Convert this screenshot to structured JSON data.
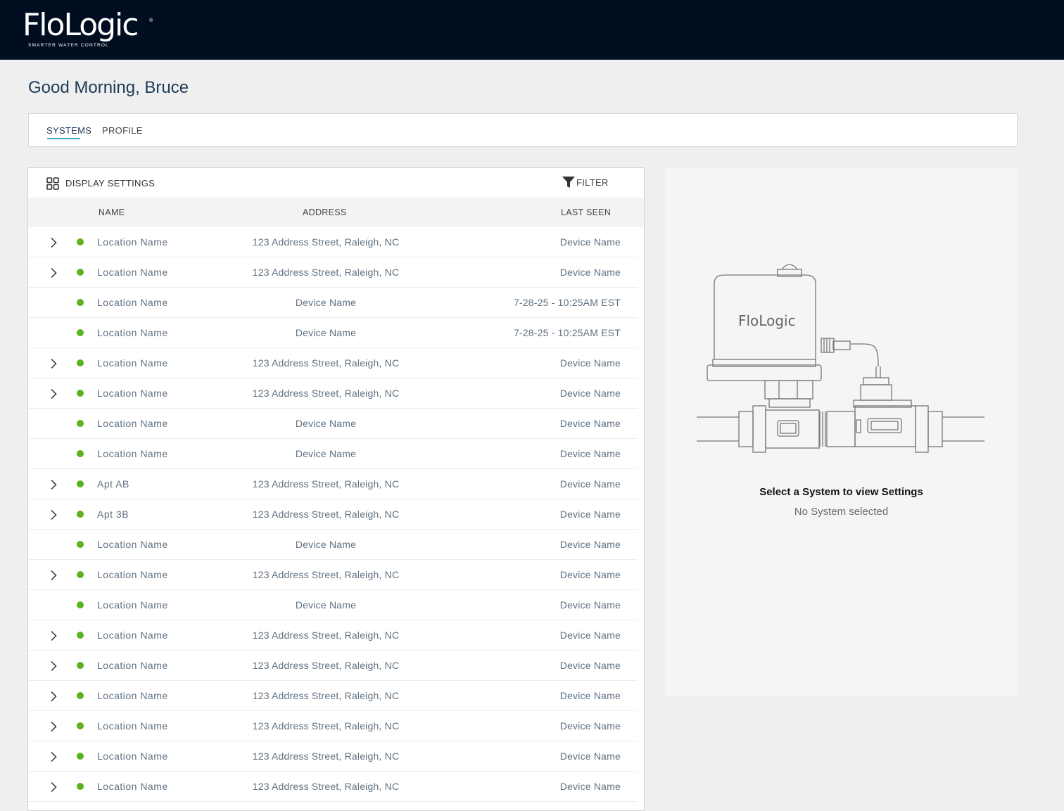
{
  "brand": {
    "name": "FloLogic",
    "registered_mark": "®",
    "tagline": "SMARTER WATER CONTROL"
  },
  "greeting": "Good Morning, Bruce",
  "tabs": [
    {
      "label": "SYSTEMS",
      "active": true
    },
    {
      "label": "PROFILE",
      "active": false
    }
  ],
  "toolbar": {
    "display_settings_label": "DISPLAY SETTINGS",
    "filter_label": "FILTER"
  },
  "table": {
    "columns": {
      "name": "NAME",
      "address": "ADDRESS",
      "last_seen": "LAST SEEN"
    },
    "rows": [
      {
        "expandable": true,
        "status": "online",
        "name": "Location  Name",
        "address": "123 Address Street, Raleigh, NC",
        "last_seen": "Device Name"
      },
      {
        "expandable": true,
        "status": "online",
        "name": "Location  Name",
        "address": "123 Address Street, Raleigh, NC",
        "last_seen": "Device Name"
      },
      {
        "expandable": false,
        "status": "online",
        "name": "Location  Name",
        "address": "Device Name",
        "last_seen": "7-28-25 - 10:25AM EST"
      },
      {
        "expandable": false,
        "status": "online",
        "name": "Location  Name",
        "address": "Device Name",
        "last_seen": "7-28-25 - 10:25AM EST"
      },
      {
        "expandable": true,
        "status": "online",
        "name": "Location  Name",
        "address": "123 Address Street, Raleigh, NC",
        "last_seen": "Device Name"
      },
      {
        "expandable": true,
        "status": "online",
        "name": "Location  Name",
        "address": "123 Address Street, Raleigh, NC",
        "last_seen": "Device Name"
      },
      {
        "expandable": false,
        "status": "online",
        "name": "Location  Name",
        "address": "Device Name",
        "last_seen": "Device Name"
      },
      {
        "expandable": false,
        "status": "online",
        "name": "Location  Name",
        "address": "Device Name",
        "last_seen": "Device Name"
      },
      {
        "expandable": true,
        "status": "online",
        "name": "Apt AB",
        "address": "123 Address Street, Raleigh, NC",
        "last_seen": "Device Name"
      },
      {
        "expandable": true,
        "status": "online",
        "name": "Apt 3B",
        "address": "123 Address Street, Raleigh, NC",
        "last_seen": "Device Name"
      },
      {
        "expandable": false,
        "status": "online",
        "name": "Location  Name",
        "address": "Device Name",
        "last_seen": "Device Name"
      },
      {
        "expandable": true,
        "status": "online",
        "name": "Location  Name",
        "address": "123 Address Street, Raleigh, NC",
        "last_seen": "Device Name"
      },
      {
        "expandable": false,
        "status": "online",
        "name": "Location  Name",
        "address": "Device Name",
        "last_seen": "Device Name"
      },
      {
        "expandable": true,
        "status": "online",
        "name": "Location  Name",
        "address": "123 Address Street, Raleigh, NC",
        "last_seen": "Device Name"
      },
      {
        "expandable": true,
        "status": "online",
        "name": "Location  Name",
        "address": "123 Address Street, Raleigh, NC",
        "last_seen": "Device Name"
      },
      {
        "expandable": true,
        "status": "online",
        "name": "Location  Name",
        "address": "123 Address Street, Raleigh, NC",
        "last_seen": "Device Name"
      },
      {
        "expandable": true,
        "status": "online",
        "name": "Location  Name",
        "address": "123 Address Street, Raleigh, NC",
        "last_seen": "Device Name"
      },
      {
        "expandable": true,
        "status": "online",
        "name": "Location  Name",
        "address": "123 Address Street, Raleigh, NC",
        "last_seen": "Device Name"
      },
      {
        "expandable": true,
        "status": "online",
        "name": "Location  Name",
        "address": "123 Address Street, Raleigh, NC",
        "last_seen": "Device Name"
      }
    ]
  },
  "detail_panel": {
    "device_brand": "FloLogic",
    "title": "Select a System to view Settings",
    "subtitle": "No System selected"
  },
  "colors": {
    "header_bg": "#010e21",
    "accent": "#3fa7c7",
    "status_online": "#5ab21c",
    "greeting": "#1d3a57"
  },
  "icons": {
    "display_settings": "grid-icon",
    "filter": "funnel-icon",
    "expand": "chevron-right-icon",
    "status": "status-dot-icon"
  }
}
